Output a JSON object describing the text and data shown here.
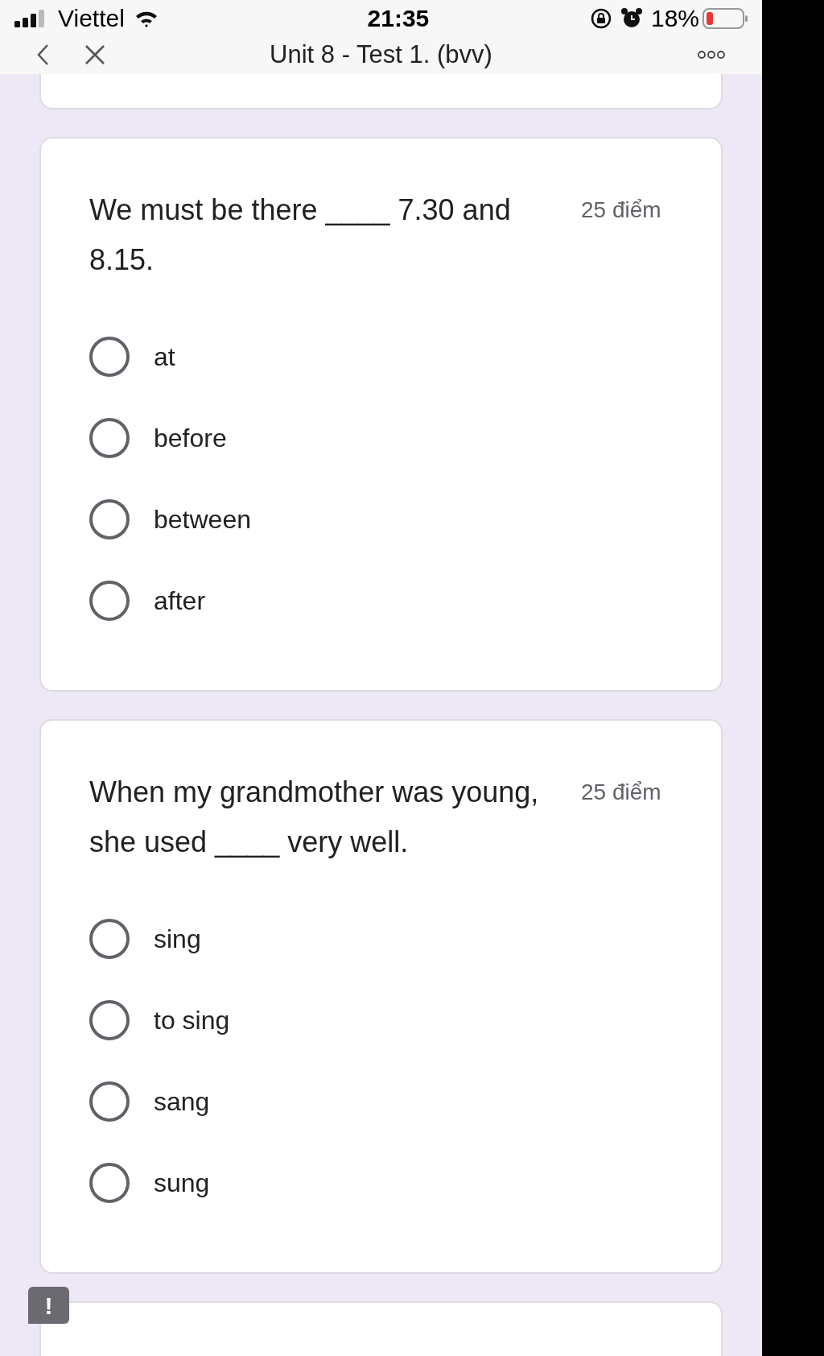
{
  "status_bar": {
    "carrier": "Viettel",
    "time": "21:35",
    "battery": "18%"
  },
  "nav": {
    "title": "Unit 8 - Test 1. (bvv)"
  },
  "questions": [
    {
      "text": "We must be there ____ 7.30 and 8.15.",
      "points": "25 điểm",
      "options": [
        {
          "label": "at",
          "selected": false
        },
        {
          "label": "before",
          "selected": false
        },
        {
          "label": "between",
          "selected": false
        },
        {
          "label": "after",
          "selected": false
        }
      ]
    },
    {
      "text": "When my grandmother was young, she used ____ very well.",
      "points": "25 điểm",
      "options": [
        {
          "label": "sing",
          "selected": false
        },
        {
          "label": "to sing",
          "selected": false
        },
        {
          "label": "sang",
          "selected": false
        },
        {
          "label": "sung",
          "selected": false
        }
      ]
    }
  ],
  "feedback_button": {
    "label": "!"
  }
}
